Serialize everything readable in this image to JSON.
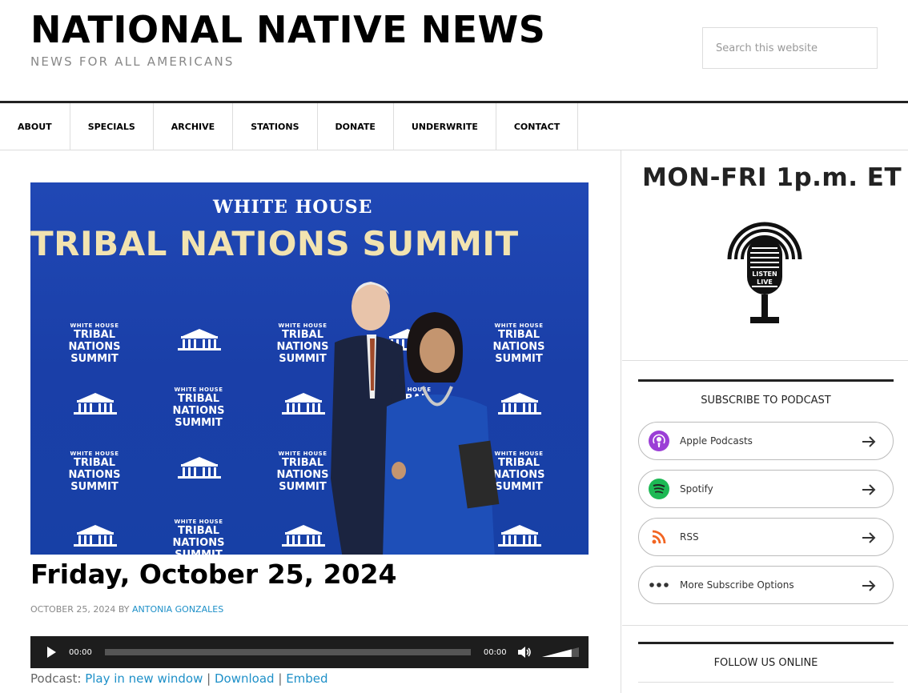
{
  "header": {
    "title": "NATIONAL NATIVE NEWS",
    "tagline": "NEWS FOR ALL AMERICANS",
    "search_placeholder": "Search this website"
  },
  "nav": {
    "items": [
      {
        "label": "ABOUT"
      },
      {
        "label": "SPECIALS"
      },
      {
        "label": "ARCHIVE"
      },
      {
        "label": "STATIONS"
      },
      {
        "label": "DONATE"
      },
      {
        "label": "UNDERWRITE"
      },
      {
        "label": "CONTACT"
      }
    ]
  },
  "hero": {
    "small_title": "WHITE HOUSE",
    "big_title": "TRIBAL NATIONS SUMMIT",
    "logo_small": "WHITE HOUSE",
    "logo_line1": "TRIBAL NATIONS",
    "logo_line2": "SUMMIT"
  },
  "post": {
    "title": "Friday, October 25, 2024",
    "date": "OCTOBER 25, 2024",
    "by": "BY",
    "author": "ANTONIA GONZALES"
  },
  "player": {
    "current_time": "00:00",
    "duration": "00:00",
    "progress": 0,
    "volume": 0.8
  },
  "podcast": {
    "prefix": "Podcast:",
    "play_new_window": "Play in new window",
    "sep1": "|",
    "download": "Download",
    "sep2": "|",
    "embed": "Embed"
  },
  "sidebar": {
    "schedule": "MON-FRI 1p.m. ET",
    "mic_line1": "LISTEN",
    "mic_line2": "LIVE",
    "subscribe_title": "SUBSCRIBE TO PODCAST",
    "subscribe_options": [
      {
        "label": "Apple Podcasts",
        "icon": "apple-podcasts-icon",
        "color": "#9b3ed6"
      },
      {
        "label": "Spotify",
        "icon": "spotify-icon",
        "color": "#1db954"
      },
      {
        "label": "RSS",
        "icon": "rss-icon",
        "color": "#f26522"
      },
      {
        "label": "More Subscribe Options",
        "icon": "more-dots-icon",
        "color": "#333333"
      }
    ],
    "follow_title": "FOLLOW US ONLINE"
  }
}
